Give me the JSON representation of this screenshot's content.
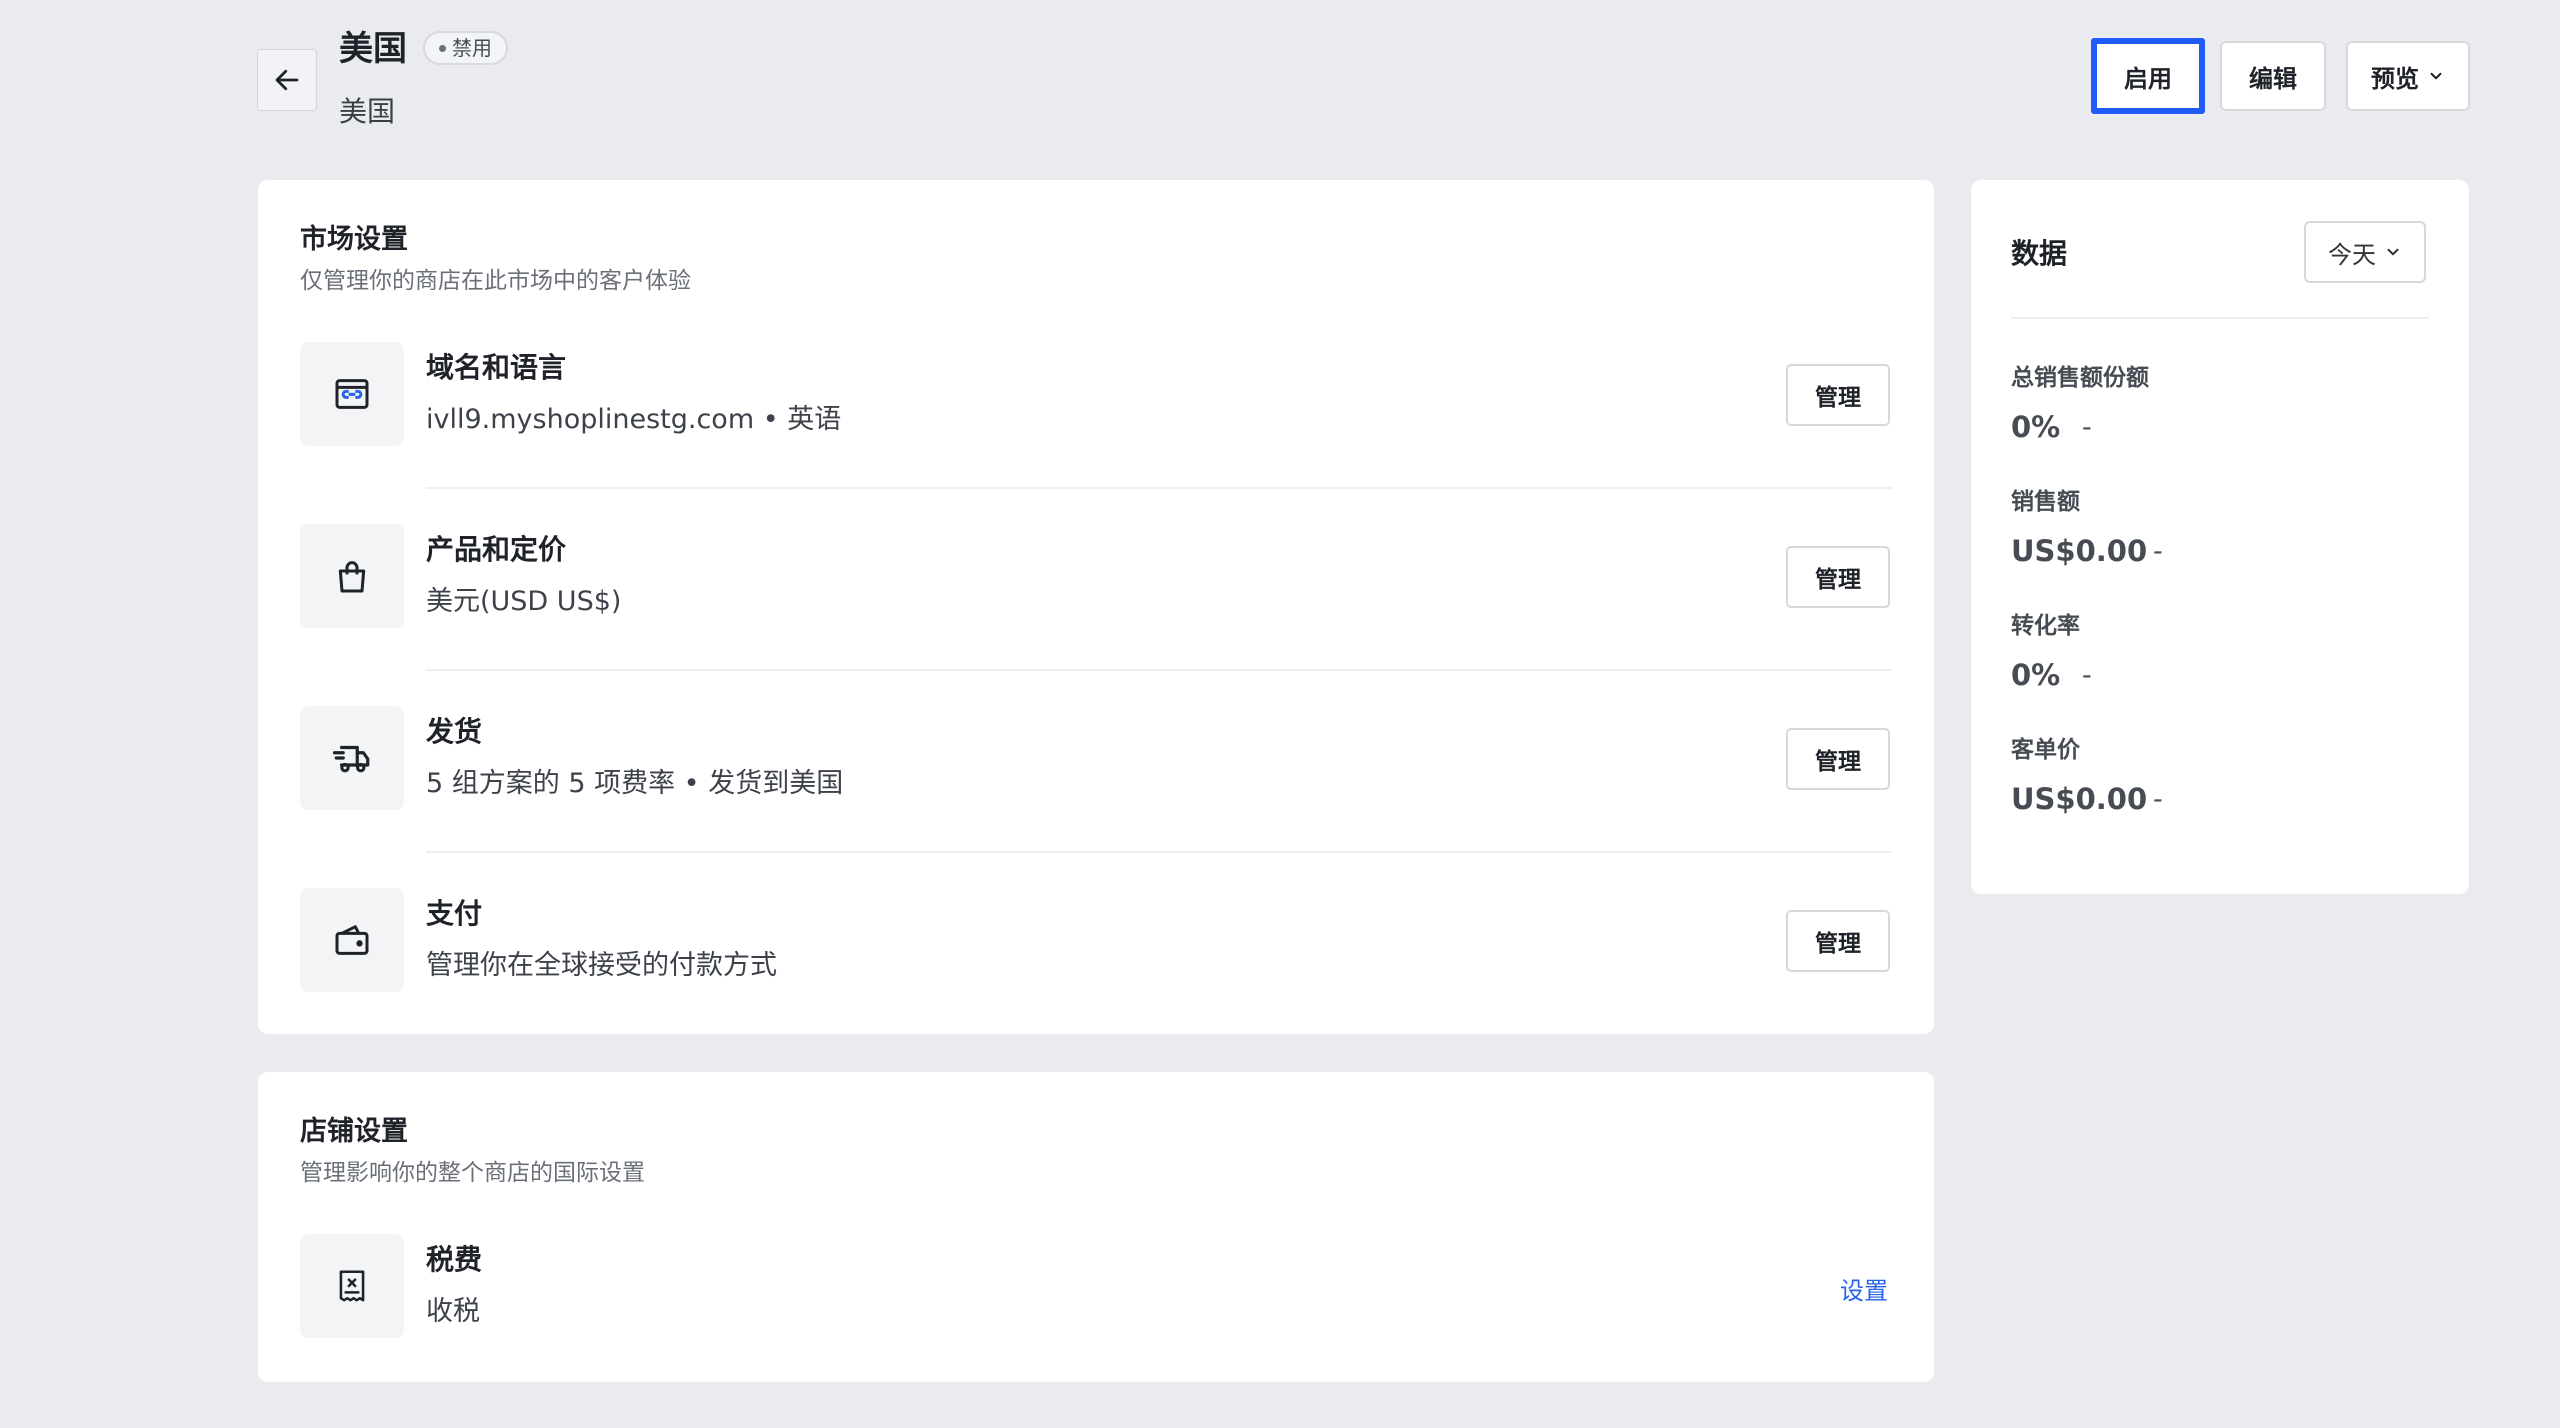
{
  "header": {
    "title": "美国",
    "status": "禁用",
    "subtitle": "美国",
    "buttons": {
      "enable": "启用",
      "edit": "编辑",
      "preview": "预览"
    }
  },
  "market_settings": {
    "title": "市场设置",
    "description": "仅管理你的商店在此市场中的客户体验",
    "rows": [
      {
        "icon": "domain-icon",
        "title": "域名和语言",
        "description": "ivll9.myshoplinestg.com • 英语",
        "action": "管理"
      },
      {
        "icon": "shopping-bag-icon",
        "title": "产品和定价",
        "description": "美元(USD US$)",
        "action": "管理"
      },
      {
        "icon": "delivery-truck-icon",
        "title": "发货",
        "description": "5 组方案的 5 项费率 • 发货到美国",
        "action": "管理"
      },
      {
        "icon": "wallet-icon",
        "title": "支付",
        "description": "管理你在全球接受的付款方式",
        "action": "管理"
      }
    ]
  },
  "store_settings": {
    "title": "店铺设置",
    "description": "管理影响你的整个商店的国际设置",
    "rows": [
      {
        "icon": "tax-receipt-icon",
        "title": "税费",
        "description": "收税",
        "action": "设置"
      }
    ]
  },
  "data_panel": {
    "title": "数据",
    "range": "今天",
    "metrics": [
      {
        "label": "总销售额份额",
        "value": "0%",
        "change": "-"
      },
      {
        "label": "销售额",
        "value": "US$0.00",
        "change": "-"
      },
      {
        "label": "转化率",
        "value": "0%",
        "change": "-"
      },
      {
        "label": "客单价",
        "value": "US$0.00",
        "change": "-"
      }
    ]
  },
  "colors": {
    "accent": "#1f5cf5",
    "link": "#2563eb",
    "background": "#e9ebef"
  }
}
